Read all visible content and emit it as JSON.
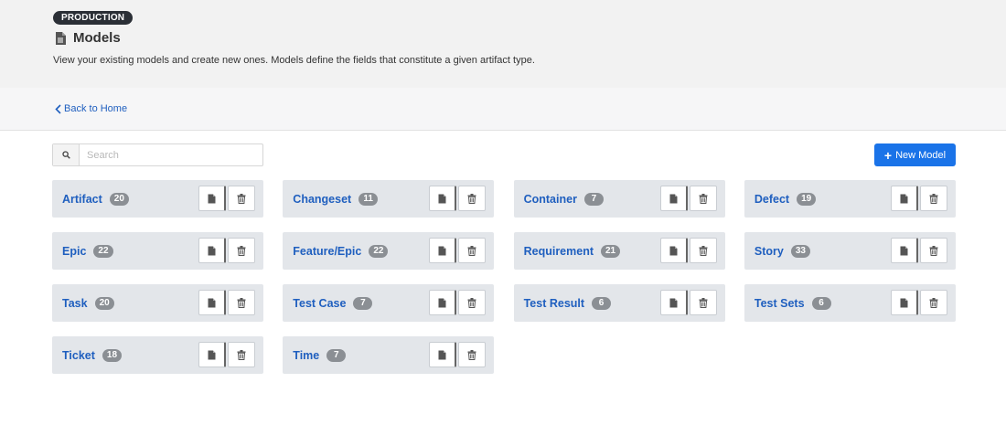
{
  "header": {
    "env_badge": "PRODUCTION",
    "title": "Models",
    "description": "View your existing models and create new ones. Models define the fields that constitute a given artifact type."
  },
  "nav": {
    "back_label": "Back to Home"
  },
  "search": {
    "placeholder": "Search",
    "value": ""
  },
  "toolbar": {
    "new_model_label": "New Model"
  },
  "colors": {
    "accent": "#1a73e8",
    "link": "#1f5fbf",
    "badge": "#8b8f94",
    "card_bg": "#e3e6ea"
  },
  "models": [
    {
      "name": "Artifact",
      "count": "20"
    },
    {
      "name": "Changeset",
      "count": "11"
    },
    {
      "name": "Container",
      "count": "7"
    },
    {
      "name": "Defect",
      "count": "19"
    },
    {
      "name": "Epic",
      "count": "22"
    },
    {
      "name": "Feature/Epic",
      "count": "22"
    },
    {
      "name": "Requirement",
      "count": "21"
    },
    {
      "name": "Story",
      "count": "33"
    },
    {
      "name": "Task",
      "count": "20"
    },
    {
      "name": "Test Case",
      "count": "7"
    },
    {
      "name": "Test Result",
      "count": "6"
    },
    {
      "name": "Test Sets",
      "count": "6"
    },
    {
      "name": "Ticket",
      "count": "18"
    },
    {
      "name": "Time",
      "count": "7"
    }
  ],
  "icons": {
    "doc": "document-icon",
    "search": "search-icon",
    "copy": "copy-icon",
    "delete": "trash-icon",
    "back": "chevron-left-icon",
    "add": "plus-icon"
  }
}
